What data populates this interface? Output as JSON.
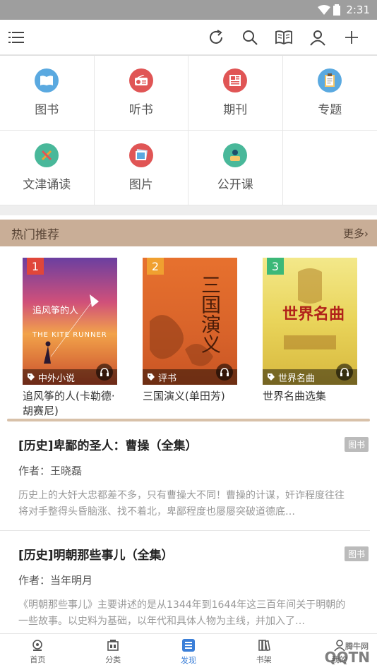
{
  "status": {
    "time": "2:31"
  },
  "toolbar": {
    "icons": [
      "menu-icon",
      "refresh-icon",
      "search-icon",
      "open-book-icon",
      "user-icon",
      "plus-icon"
    ]
  },
  "categories": [
    {
      "label": "图书",
      "color": "#5aa9e0",
      "icon": "book-icon"
    },
    {
      "label": "听书",
      "color": "#e05555",
      "icon": "radio-icon"
    },
    {
      "label": "期刊",
      "color": "#e05555",
      "icon": "newspaper-icon"
    },
    {
      "label": "专题",
      "color": "#5aa9e0",
      "icon": "clipboard-icon"
    },
    {
      "label": "文津诵读",
      "color": "#49b89a",
      "icon": "brush-icon"
    },
    {
      "label": "图片",
      "color": "#e05555",
      "icon": "picture-icon"
    },
    {
      "label": "公开课",
      "color": "#49b89a",
      "icon": "lecture-icon"
    }
  ],
  "hot": {
    "title": "热门推荐",
    "more": "更多›",
    "books": [
      {
        "rank": "1",
        "rank_color": "#e0463a",
        "tag": "中外小说",
        "title": "追风筝的人(卡勒德·胡赛尼)",
        "cover_title": "追风筝的人",
        "cover_sub": "THE KITE RUNNER"
      },
      {
        "rank": "2",
        "rank_color": "#f0a030",
        "tag": "评书",
        "title": "三国演义(单田芳)",
        "cover_title": "三国演义"
      },
      {
        "rank": "3",
        "rank_color": "#3cb878",
        "tag": "世界名曲",
        "title": "世界名曲选集",
        "cover_title": "世界名曲"
      }
    ]
  },
  "articles": [
    {
      "title": "[历史]卑鄙的圣人：曹操（全集）",
      "badge": "图书",
      "author": "作者：王晓磊",
      "desc": "历史上的大奸大忠都差不多，只有曹操大不同！曹操的计谋，奸诈程度往往将对手整得头昏脑涨、找不着北，卑鄙程度也屡屡突破道德底…"
    },
    {
      "title": "[历史]明朝那些事儿（全集）",
      "badge": "图书",
      "author": "作者：当年明月",
      "desc": "《明朝那些事儿》主要讲述的是从1344年到1644年这三百年间关于明朝的一些故事。以史料为基础，以年代和具体人物为主线，并加入了…"
    }
  ],
  "nav": [
    {
      "label": "首页",
      "icon": "home-icon",
      "active": false
    },
    {
      "label": "分类",
      "icon": "category-icon",
      "active": false
    },
    {
      "label": "发现",
      "icon": "discover-icon",
      "active": true
    },
    {
      "label": "书架",
      "icon": "shelf-icon",
      "active": false
    },
    {
      "label": "我的",
      "icon": "profile-icon",
      "active": false
    }
  ],
  "watermark": {
    "text": "QQTN",
    "small": "腾牛网"
  }
}
